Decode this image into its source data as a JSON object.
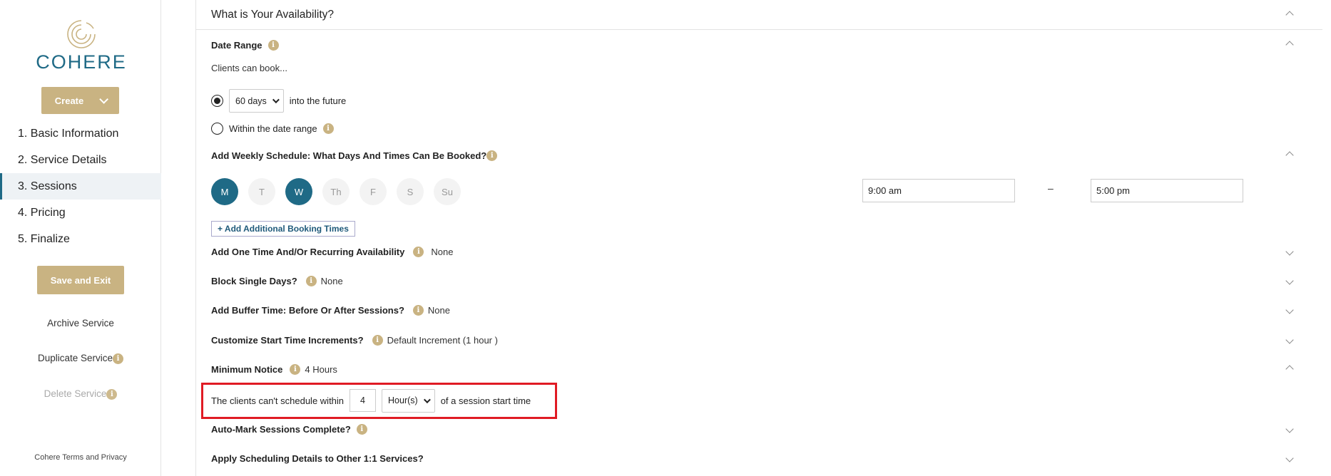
{
  "brand": {
    "logo_text": "COHERE",
    "accent": "#1f6a86",
    "gold": "#c9b382"
  },
  "sidebar": {
    "create_label": "Create",
    "steps": [
      {
        "label": "1. Basic Information"
      },
      {
        "label": "2. Service Details"
      },
      {
        "label": "3. Sessions",
        "active": true
      },
      {
        "label": "4. Pricing"
      },
      {
        "label": "5. Finalize"
      }
    ],
    "save_label": "Save and Exit",
    "archive_label": "Archive Service",
    "duplicate_label": "Duplicate Service",
    "delete_label": "Delete Service",
    "terms_label": "Cohere Terms and Privacy",
    "info_glyph": "i"
  },
  "availability": {
    "header": "What is Your Availability?",
    "date_range": {
      "title": "Date Range",
      "subtitle": "Clients can book...",
      "future_option_value": "60 days",
      "future_option_suffix": "into the future",
      "range_option_label": "Within the date range",
      "selected": "future"
    },
    "weekly": {
      "title": "Add Weekly Schedule: What Days And Times Can Be Booked?",
      "days": [
        {
          "label": "M",
          "on": true
        },
        {
          "label": "T",
          "on": false
        },
        {
          "label": "W",
          "on": true
        },
        {
          "label": "Th",
          "on": false
        },
        {
          "label": "F",
          "on": false
        },
        {
          "label": "S",
          "on": false
        },
        {
          "label": "Su",
          "on": false
        }
      ],
      "start_time": "9:00 am",
      "separator": "–",
      "end_time": "5:00 pm",
      "add_times_label": "+ Add Additional Booking Times"
    },
    "one_time": {
      "title": "Add One Time And/Or Recurring Availability",
      "value": "None"
    },
    "block_days": {
      "title": "Block Single Days?",
      "value": "None"
    },
    "buffer": {
      "title": "Add Buffer Time: Before Or After Sessions?",
      "value": "None"
    },
    "increments": {
      "title": "Customize Start Time Increments?",
      "value": "Default Increment (1 hour )"
    },
    "min_notice": {
      "title": "Minimum Notice",
      "value": "4 Hours",
      "prefix": "The clients can't schedule within",
      "amount": "4",
      "unit": "Hour(s)",
      "suffix": "of a session start time"
    },
    "auto_mark": {
      "title": "Auto-Mark Sessions Complete?"
    },
    "apply_details": {
      "title": "Apply Scheduling Details to Other 1:1 Services?"
    }
  }
}
